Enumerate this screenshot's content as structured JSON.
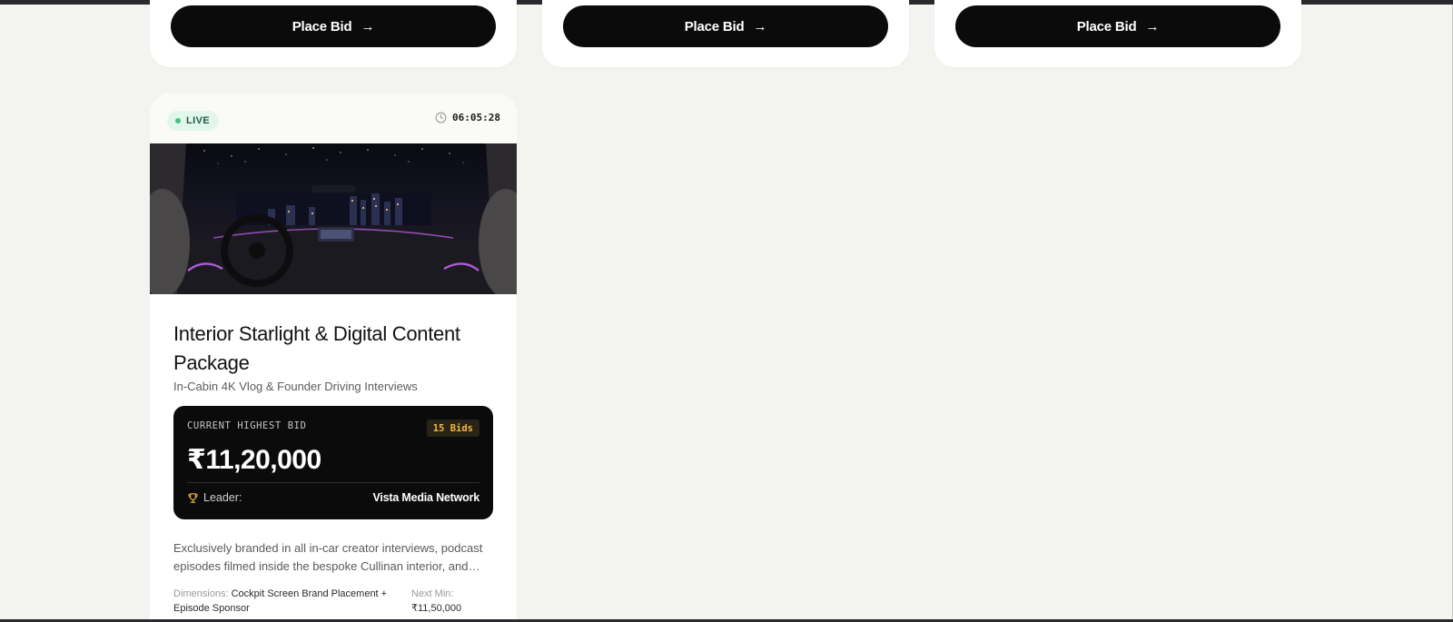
{
  "top_row_cards": [
    {
      "button_label": "Place Bid"
    },
    {
      "button_label": "Place Bid"
    },
    {
      "button_label": "Place Bid"
    }
  ],
  "card": {
    "status": "LIVE",
    "timer": "06:05:28",
    "title": "Interior Starlight & Digital Content Package",
    "subtitle": "In-Cabin 4K Vlog & Founder Driving Interviews",
    "bid": {
      "label": "CURRENT HIGHEST BID",
      "count": "15 Bids",
      "amount": "₹11,20,000",
      "leader_label": "Leader:",
      "leader_name": "Vista Media Network"
    },
    "description": "Exclusively branded in all in-car creator interviews, podcast episodes filmed inside the bespoke Cullinan interior, and…",
    "dimensions_label": "Dimensions:",
    "dimensions_value": "Cockpit Screen Brand Placement + Episode Sponsor",
    "next_min_label": "Next Min:",
    "next_min_value": "₹11,50,000"
  },
  "colors": {
    "page_bg": "#f3f3ef",
    "button_bg": "#0b0b0b",
    "live_badge_bg": "#e2f6ec",
    "live_dot": "#3fc481",
    "bids_count_text": "#f2b83a"
  }
}
